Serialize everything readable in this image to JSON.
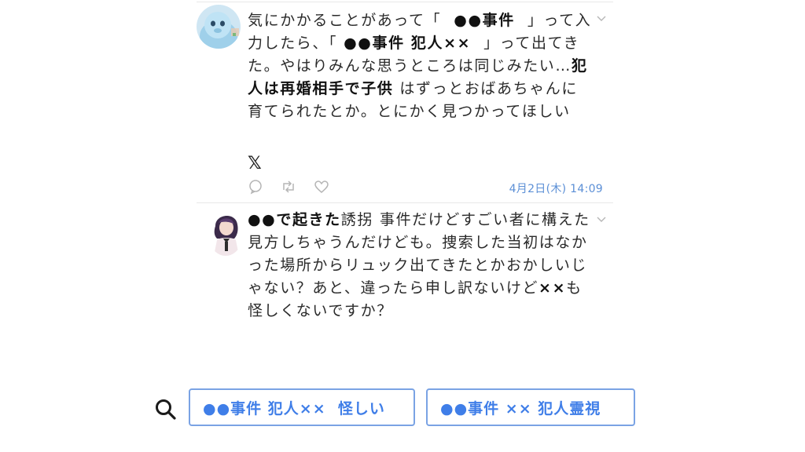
{
  "tweets": [
    {
      "avatar_icon": "blue-mascot-avatar",
      "segments": {
        "s1": "気にかかることがあって「",
        "s2": "●●事件",
        "s3": "」って入力したら、「",
        "s4": "●●事件 犯人××",
        "s5": "」って出てきた。やはりみんな思うところは同じみたい…",
        "s6": "犯人は再婚相手で子供",
        "s7": "はずっとおばあちゃんに育てられたとか。とにかく見つかってほしい"
      },
      "source_icon": "𝕏",
      "actions": [
        "reply-icon",
        "retweet-icon",
        "like-icon"
      ],
      "timestamp": "4月2日(木) 14:09"
    },
    {
      "avatar_icon": "anime-character-avatar",
      "segments": {
        "s1": "●●で起きた",
        "s2": "誘拐",
        "s3": "事件だけどすごい者に構えた見方しちゃうんだけども。捜索した当初はなかった場所からリュック出てきたとかおかしいじゃない？あと、違ったら申し訳ないけど",
        "s4": "××",
        "s5": "も怪しくないですか？"
      }
    }
  ],
  "search": {
    "icon": "search-icon",
    "suggestions": [
      "●●事件 犯人××  怪しい",
      "●●事件 ×× 犯人霊視"
    ]
  },
  "colors": {
    "accent": "#3f7ee8",
    "chip_border": "#7aa3e4",
    "timestamp": "#5b8fd6",
    "divider": "#e8e8e8"
  }
}
